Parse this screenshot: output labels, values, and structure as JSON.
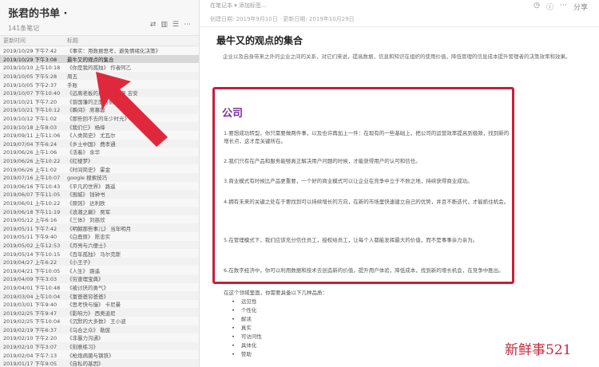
{
  "notebook": {
    "title": "张君的书单 ·",
    "count": "141条笔记",
    "tools": [
      "⇄",
      "▥",
      "☰",
      "⋯"
    ],
    "columns": [
      "更新时间",
      "标题"
    ],
    "rows": [
      {
        "time": "2019/10/29 下午7:42",
        "title": "《事实：用数据思考，避免情绪化决策》"
      },
      {
        "time": "2019/10/29 下午3:08",
        "title": "最牛又的观点的集合"
      },
      {
        "time": "2019/10/10 上午10:18",
        "title": "《你是我的孤独》 作者阿乙"
      },
      {
        "time": "2019/10/05 下午5:28",
        "title": "周五"
      },
      {
        "time": "2019/10/05 下午2:37",
        "title": "手账"
      },
      {
        "time": "2019/10/07 下午10:40",
        "title": "《远离老板的风格》 作者 吉安"
      },
      {
        "time": "2019/10/21 下午7:20",
        "title": "《曾国藩的正面与侧面》"
      },
      {
        "time": "2019/10/21 下午10:12",
        "title": "《瞬间》 席慕蓉"
      },
      {
        "time": "2019/10/12 下午1:02",
        "title": "《那些回不去的年少时光》"
      },
      {
        "time": "2019/10/18 上午8:03",
        "title": "《我们仨》 杨绛"
      },
      {
        "time": "2019/09/11 上午11:06",
        "title": "《人类简史》 尤瓦尔"
      },
      {
        "time": "2019/07/04 下午6:24",
        "title": "《乡土中国》 费孝通"
      },
      {
        "time": "2019/06/26 上午1:06",
        "title": "《活着》 余华"
      },
      {
        "time": "2019/06/26 上午10:22",
        "title": "《红楼梦》"
      },
      {
        "time": "2019/06/26 上午1:02",
        "title": "《时间简史》 霍金"
      },
      {
        "time": "2019/07/16 上午10:07",
        "title": "google 搜索技巧"
      },
      {
        "time": "2019/06/16 下午10:43",
        "title": "《平凡的世界》 路遥"
      },
      {
        "time": "2019/06/07 下午11:05",
        "title": "《围城》 钱钟书"
      },
      {
        "time": "2019/06/01 上午10:22",
        "title": "《原则》 达利欧"
      },
      {
        "time": "2019/06/18 下午11:19",
        "title": "《浪潮之巅》 吴军"
      },
      {
        "time": "2019/05/12 上午6:16",
        "title": "《三体》 刘慈欣"
      },
      {
        "time": "2019/05/11 下午7:42",
        "title": "《明朝那些事儿》 当年明月"
      },
      {
        "time": "2019/05/11 下午9:40",
        "title": "《白鹿原》 陈忠实"
      },
      {
        "time": "2019/05/02 上午12:53",
        "title": "《月亮与六便士》"
      },
      {
        "time": "2019/05/14 下午10:15",
        "title": "《百年孤独》 马尔克斯"
      },
      {
        "time": "2019/04/27 上午6:22",
        "title": "《小王子》"
      },
      {
        "time": "2019/04/21 下午10:05",
        "title": "《人生》 路遥"
      },
      {
        "time": "2019/04/09 下午3:03",
        "title": "《穷查理宝典》"
      },
      {
        "time": "2019/04/01 下午10:48",
        "title": "《被讨厌的勇气》"
      },
      {
        "time": "2019/03/04 上午10:04",
        "title": "《富爸爸穷爸爸》"
      },
      {
        "time": "2019/03/01 下午9:40",
        "title": "《思考快与慢》 卡尼曼"
      },
      {
        "time": "2019/02/25 下午9:47",
        "title": "《影响力》 西奥迪尼"
      },
      {
        "time": "2019/02/25 下午10:04",
        "title": "《沉默的大多数》 王小波"
      },
      {
        "time": "2019/02/19 下午6:37",
        "title": "《乌合之众》 勒庞"
      },
      {
        "time": "2019/02/10 下午2:20",
        "title": "《非暴力沟通》"
      },
      {
        "time": "2019/02/10 下午3:07",
        "title": "《刻意练习》"
      },
      {
        "time": "2019/02/04 下午7:13",
        "title": "《枪炮病菌与钢铁》"
      },
      {
        "time": "2019/01/17 下午9:05",
        "title": "《自私的基因》"
      },
      {
        "time": "2019/01/10 下午11:15",
        "title": "《史记》 司马迁"
      },
      {
        "time": "2019/01/05 下午10:30",
        "title": "《论语》"
      }
    ]
  },
  "document": {
    "meta": "在笔记本 ▾ 添加标签...",
    "meta_sub": "创建日期: 2019年9月10日 · 更新日期: 2019年10月29日",
    "tools": [
      "◷",
      "ⓘ",
      "⋯",
      "分享"
    ],
    "title": "最牛又的观点的集合",
    "intro": "企业以及自身带来之外的企业之间的关系，对它们来说，提高数据，信息和知识在组织的使用价值，降低管理的信息成本提升管理者的决策效率和效果。",
    "section_title": "公司",
    "points": [
      "1.要想成功转型，你只需要做两件事，以及也许再加上一件：在现有的一些基础上，把公司的运营效率提高到极致，找到新的增长点，这才是关键所在。",
      "2.我们只有在产品和服务能够真正解决用户问题的时候，才能获得用户的认可和信任。",
      "3.商业模式有时候比产品更重要，一个好的商业模式可以让企业在竞争中立于不败之地，持续获得商业成功。",
      "4.拥有未来的关键之处在于要找到可以持续增长的方向，在新的市场里快速建立自己的优势，并且不断迭代，才能抓住机会。",
      "5.在管理模式下，我们应该充分信任员工，授权给员工，让每个人都能发挥最大的价值，而不是事事亲力亲为。",
      "6.在数字经济中，你可以利用数据和技术去创造新的价值，提升用户体验，降低成本，找到新的增长机会，在竞争中胜出。"
    ],
    "trait_intro": "在这个领域里面，你需要具备以下几种品质：",
    "traits": [
      "远见性",
      "个性化",
      "解读",
      "真实",
      "可访问性",
      "具体化",
      "赞助"
    ]
  },
  "colors": {
    "highlight": "#c81e3c",
    "arrow": "#e0283c",
    "section_title": "#7a2f9e"
  },
  "watermark": "新鲜事521"
}
